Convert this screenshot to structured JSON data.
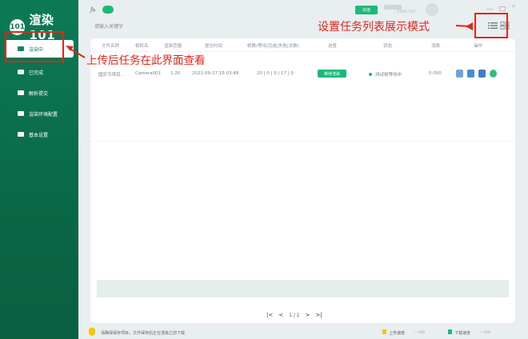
{
  "app": {
    "logo_mark": "101",
    "logo_text": "渲染101"
  },
  "sidebar": {
    "items": [
      {
        "label": "渲染中",
        "active": true
      },
      {
        "label": "已完成"
      },
      {
        "label": "解析提交"
      },
      {
        "label": "渲染环境配置"
      },
      {
        "label": "基本设置"
      }
    ]
  },
  "topbar": {
    "search_placeholder": "请输入关键字",
    "badge_label": "充值",
    "user_id": "1990.197"
  },
  "table": {
    "headers": [
      "文件名称",
      "相机名",
      "渲染范围",
      "提交时间",
      "帧数(等待|完成|失败|总数)",
      "进度",
      "状态",
      "消费",
      "操作"
    ],
    "rows": [
      {
        "file_name": "国庆节项目...",
        "camera": "Camera001",
        "range": "1-20",
        "submit_time": "2021-09-27 15:03:48",
        "frames": "20 | 0 | 0 | 17 | 0",
        "progress": "等待渲染",
        "status": "测试帧等待中",
        "cost": "0.000"
      }
    ]
  },
  "pager": {
    "first": "|<",
    "prev": "<",
    "page_text": "1 / 1",
    "next": ">",
    "last": ">|"
  },
  "statusbar": {
    "message": "请确保保存项目，文件保存后正在渲染之前下载",
    "upload_label": "上传速度",
    "upload_value": "---/kb",
    "download_label": "下载速度",
    "download_value": "---/kb"
  },
  "annotations": {
    "left_text": "上传后任务在此界面查看",
    "right_text": "设置任务列表展示模式",
    "color": "#e1251b"
  },
  "colors": {
    "brand": "#0d7a55",
    "accent": "#1db979",
    "annotation": "#e1251b"
  }
}
